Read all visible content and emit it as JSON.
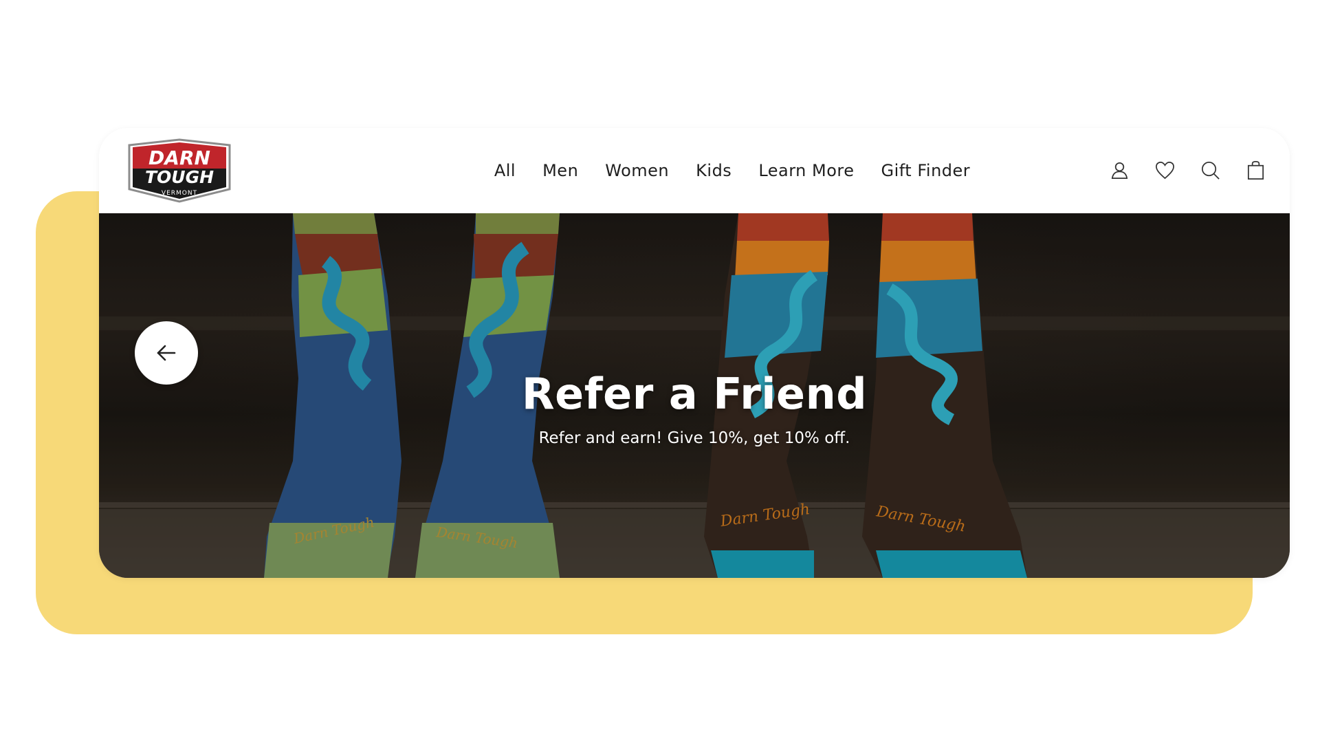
{
  "brand": {
    "logo_line1": "DARN",
    "logo_line2": "TOUGH",
    "logo_line3": "VERMONT"
  },
  "nav": {
    "links": [
      "All",
      "Men",
      "Women",
      "Kids",
      "Learn More",
      "Gift Finder"
    ],
    "icons": [
      "account-icon",
      "heart-icon",
      "search-icon",
      "shopping-bag-icon"
    ]
  },
  "hero": {
    "title": "Refer a Friend",
    "subtitle": "Refer and earn! Give 10%, get 10% off.",
    "prev_icon": "arrow-left-icon",
    "sock_brand_text": "Darn Tough"
  },
  "colors": {
    "backdrop": "#f7d978",
    "logo_red": "#c0252b",
    "logo_black": "#1a1a1a",
    "nav_text": "#1f1f1f"
  }
}
